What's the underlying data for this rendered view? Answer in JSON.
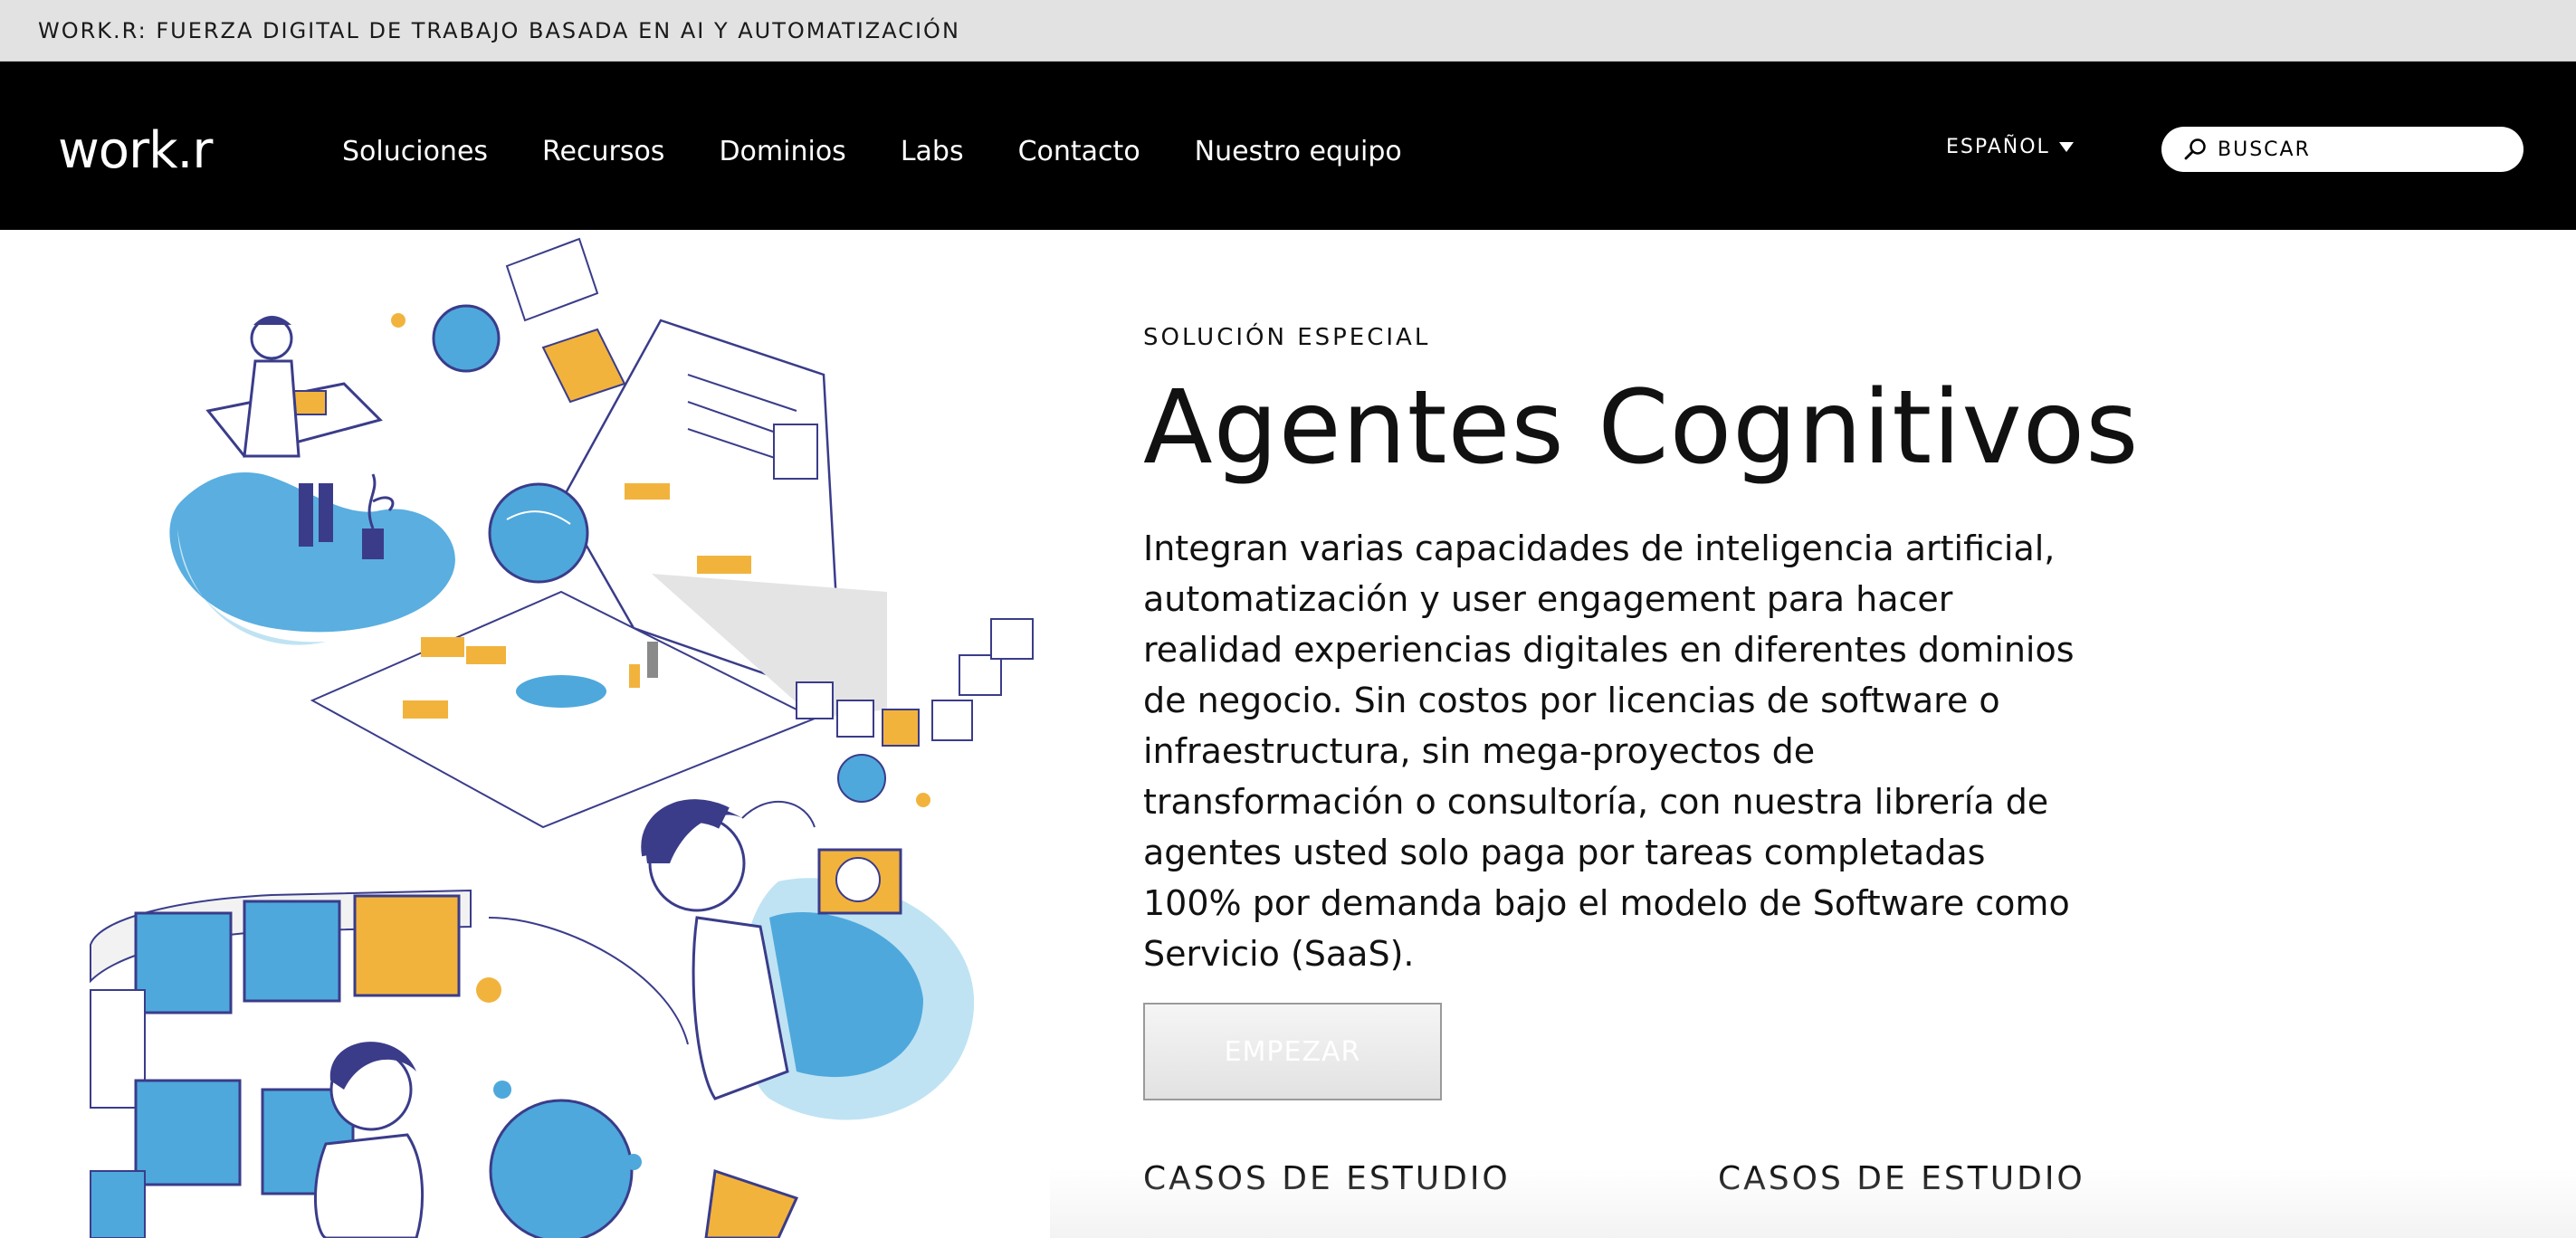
{
  "topbar": {
    "text": "WORK.R: FUERZA DIGITAL DE TRABAJO BASADA EN AI Y AUTOMATIZACIÓN"
  },
  "navbar": {
    "logo": "work.r",
    "links": [
      "Soluciones",
      "Recursos",
      "Dominios",
      "Labs",
      "Contacto",
      "Nuestro equipo"
    ],
    "language": "ESPAÑOL",
    "search_placeholder": "BUSCAR"
  },
  "hero": {
    "eyebrow": "SOLUCIÓN ESPECIAL",
    "title": "Agentes Cognitivos",
    "body": "Integran varias capacidades de inteligencia artificial, automatización y user engagement para hacer realidad experiencias digitales en diferentes dominios de negocio. Sin costos por licencias de software o infraestructura, sin mega-proyectos de transformación o consultoría, con nuestra librería de agentes usted solo paga por tareas completadas 100% por demanda bajo el modelo de Software como Servicio (SaaS).",
    "cta_label": "EMPEZAR",
    "case_studies": [
      "CASOS DE ESTUDIO",
      "CASOS DE ESTUDIO"
    ]
  },
  "colors": {
    "accent_blue": "#4ea8dc",
    "light_blue": "#bfe3f3",
    "accent_yellow": "#f2b33d",
    "outline_purple": "#3a3c8a",
    "navbar_bg": "#000000",
    "topbar_bg": "#e2e2e2"
  },
  "icons": {
    "search": "search-icon",
    "language_caret": "caret-down-icon"
  }
}
